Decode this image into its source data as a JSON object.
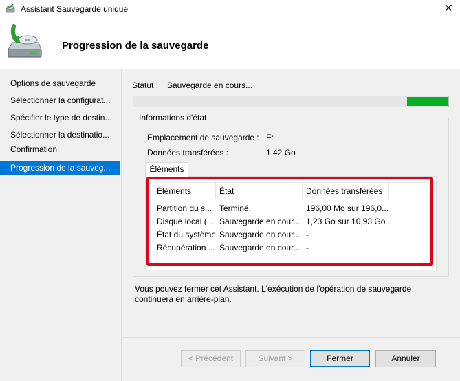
{
  "window": {
    "title": "Assistant Sauvegarde unique",
    "close_glyph": "✕"
  },
  "header": {
    "title": "Progression de la sauvegarde",
    "icon": "backup-drive-icon"
  },
  "sidebar": {
    "items": [
      {
        "label": "Options de sauvegarde",
        "active": false
      },
      {
        "label": "Sélectionner la configurat...",
        "active": false
      },
      {
        "label": "Spécifier le type de destin...",
        "active": false
      },
      {
        "label": "Sélectionner la destinatio...",
        "active": false
      },
      {
        "label": "Confirmation",
        "active": false
      },
      {
        "label": "Progression de la sauveg...",
        "active": true
      }
    ]
  },
  "status": {
    "label": "Statut :",
    "value": "Sauvegarde en cours...",
    "progress_fraction": 0.13,
    "progress_color": "#06b025"
  },
  "state_info": {
    "legend": "Informations d'état",
    "location_label": "Emplacement de sauvegarde :",
    "location_value": "E:",
    "transferred_label": "Données transférées :",
    "transferred_value": "1,42 Go"
  },
  "tab": {
    "label": "Éléments"
  },
  "items_table": {
    "columns": [
      "Éléments",
      "État",
      "Données transférées"
    ],
    "rows": [
      [
        "Partition du s...",
        "Terminé.",
        "196,00 Mo sur 196,0..."
      ],
      [
        "Disque local (...",
        "Sauvegarde en cour...",
        "1,23 Go sur 10,93 Go"
      ],
      [
        "État du système",
        "Sauvegarde en cour...",
        "-"
      ],
      [
        "Récupération ...",
        "Sauvegarde en cour...",
        "-"
      ]
    ],
    "highlight_color": "#e3001b"
  },
  "info_text": {
    "line1": "Vous pouvez fermer cet Assistant. L'exécution de l'opération de sauvegarde",
    "line2": "continuera en arrière-plan."
  },
  "buttons": {
    "previous": "< Précédent",
    "next": "Suivant >",
    "close": "Fermer",
    "cancel": "Annuler"
  }
}
